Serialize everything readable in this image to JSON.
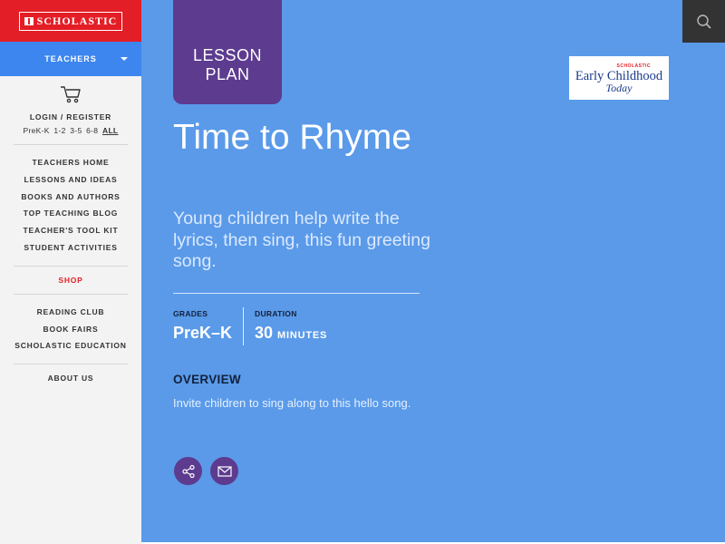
{
  "brand": {
    "name": "SCHOLASTIC",
    "red": "#e41e26",
    "blue": "#3d86f0",
    "purple": "#5d3b8f",
    "main_bg": "#5a9ae9"
  },
  "sidebar": {
    "audience_dropdown": "TEACHERS",
    "login": "LOGIN / REGISTER",
    "grades": [
      "PreK-K",
      "1-2",
      "3-5",
      "6-8",
      "ALL"
    ],
    "menu_group_1": [
      "TEACHERS HOME",
      "LESSONS AND IDEAS",
      "BOOKS AND AUTHORS",
      "TOP TEACHING BLOG",
      "TEACHER'S TOOL KIT",
      "STUDENT ACTIVITIES"
    ],
    "shop": "SHOP",
    "menu_group_2": [
      "READING CLUB",
      "BOOK FAIRS",
      "SCHOLASTIC EDUCATION"
    ],
    "about": "ABOUT US"
  },
  "main": {
    "badge_line1": "LESSON",
    "badge_line2": "PLAN",
    "title": "Time to Rhyme",
    "subtitle": "Young children help write the lyrics, then sing, this fun greeting song.",
    "grades_label": "GRADES",
    "grades_value": "PreK–K",
    "duration_label": "DURATION",
    "duration_value": "30",
    "duration_unit": "MINUTES",
    "overview_heading": "OVERVIEW",
    "overview_text": "Invite children to sing along to this hello song."
  },
  "publication_logo": {
    "top_text": "SCHOLASTIC",
    "name": "Early Childhood",
    "sub": "Today"
  },
  "icons": {
    "cart": "cart-icon",
    "search": "search-icon",
    "share": "share-icon",
    "mail": "mail-icon"
  }
}
